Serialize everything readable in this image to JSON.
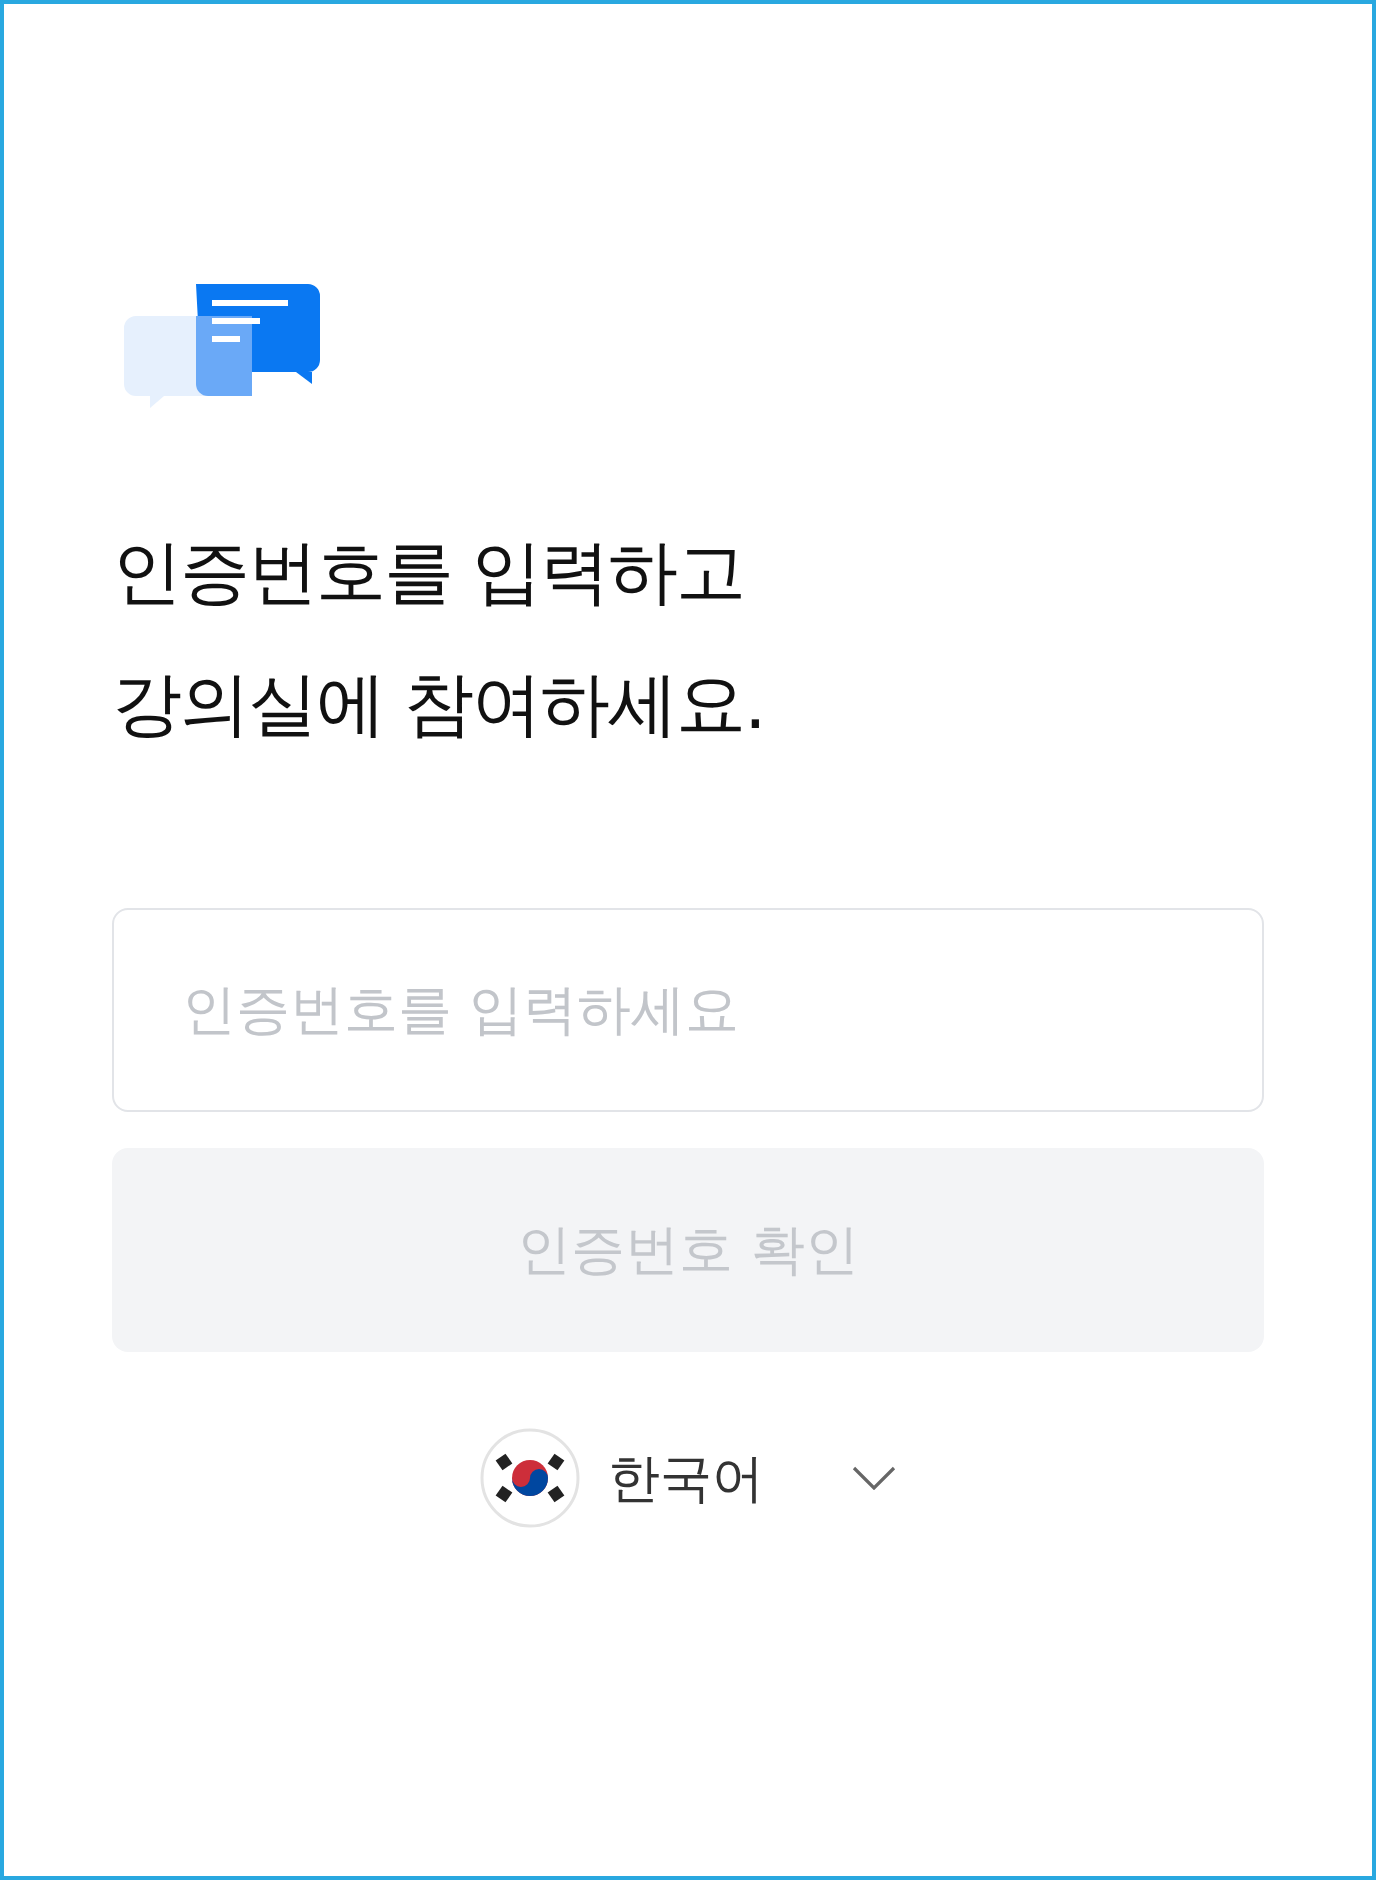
{
  "heading": [
    "인증번호를 입력하고",
    "강의실에 참여하세요."
  ],
  "code_field": {
    "placeholder": "인증번호를 입력하세요"
  },
  "confirm_button": {
    "label": "인증번호 확인",
    "disabled": true
  },
  "language": {
    "label": "한국어"
  }
}
